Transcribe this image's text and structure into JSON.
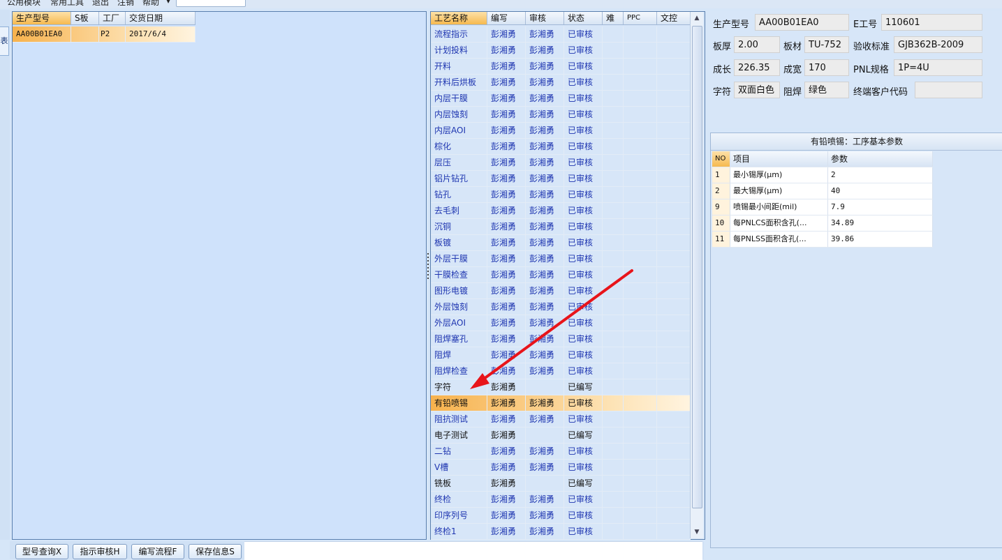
{
  "menu": {
    "items": [
      "公用模块",
      "常用工具",
      "退出",
      "注销",
      "帮助"
    ],
    "help_arrow": "▾"
  },
  "left_tab": {
    "label": "表"
  },
  "orders_grid": {
    "columns": [
      "生产型号",
      "S板",
      "工厂",
      "交货日期"
    ],
    "rows": [
      {
        "model": "AA00B01EA0",
        "s": "",
        "factory": "P2",
        "date": "2017/6/4"
      }
    ]
  },
  "process_grid": {
    "columns": [
      "工艺名称",
      "编写",
      "审核",
      "状态",
      "难",
      "PPC",
      "文控"
    ],
    "rows": [
      {
        "name": "流程指示",
        "writer": "彭湘勇",
        "reviewer": "彭湘勇",
        "status": "已审核"
      },
      {
        "name": "计划投料",
        "writer": "彭湘勇",
        "reviewer": "彭湘勇",
        "status": "已审核"
      },
      {
        "name": "开料",
        "writer": "彭湘勇",
        "reviewer": "彭湘勇",
        "status": "已审核"
      },
      {
        "name": "开料后烘板",
        "writer": "彭湘勇",
        "reviewer": "彭湘勇",
        "status": "已审核"
      },
      {
        "name": "内层干膜",
        "writer": "彭湘勇",
        "reviewer": "彭湘勇",
        "status": "已审核"
      },
      {
        "name": "内层蚀刻",
        "writer": "彭湘勇",
        "reviewer": "彭湘勇",
        "status": "已审核"
      },
      {
        "name": "内层AOI",
        "writer": "彭湘勇",
        "reviewer": "彭湘勇",
        "status": "已审核"
      },
      {
        "name": "棕化",
        "writer": "彭湘勇",
        "reviewer": "彭湘勇",
        "status": "已审核"
      },
      {
        "name": "层压",
        "writer": "彭湘勇",
        "reviewer": "彭湘勇",
        "status": "已审核"
      },
      {
        "name": "铝片钻孔",
        "writer": "彭湘勇",
        "reviewer": "彭湘勇",
        "status": "已审核"
      },
      {
        "name": "钻孔",
        "writer": "彭湘勇",
        "reviewer": "彭湘勇",
        "status": "已审核"
      },
      {
        "name": "去毛刺",
        "writer": "彭湘勇",
        "reviewer": "彭湘勇",
        "status": "已审核"
      },
      {
        "name": "沉铜",
        "writer": "彭湘勇",
        "reviewer": "彭湘勇",
        "status": "已审核"
      },
      {
        "name": "板镀",
        "writer": "彭湘勇",
        "reviewer": "彭湘勇",
        "status": "已审核"
      },
      {
        "name": "外层干膜",
        "writer": "彭湘勇",
        "reviewer": "彭湘勇",
        "status": "已审核"
      },
      {
        "name": "干膜检查",
        "writer": "彭湘勇",
        "reviewer": "彭湘勇",
        "status": "已审核"
      },
      {
        "name": "图形电镀",
        "writer": "彭湘勇",
        "reviewer": "彭湘勇",
        "status": "已审核"
      },
      {
        "name": "外层蚀刻",
        "writer": "彭湘勇",
        "reviewer": "彭湘勇",
        "status": "已审核"
      },
      {
        "name": "外层AOI",
        "writer": "彭湘勇",
        "reviewer": "彭湘勇",
        "status": "已审核"
      },
      {
        "name": "阻焊塞孔",
        "writer": "彭湘勇",
        "reviewer": "彭湘勇",
        "status": "已审核"
      },
      {
        "name": "阻焊",
        "writer": "彭湘勇",
        "reviewer": "彭湘勇",
        "status": "已审核"
      },
      {
        "name": "阻焊检查",
        "writer": "彭湘勇",
        "reviewer": "彭湘勇",
        "status": "已审核"
      },
      {
        "name": "字符",
        "writer": "彭湘勇",
        "reviewer": "",
        "status": "已编写"
      },
      {
        "name": "有铅喷锡",
        "writer": "彭湘勇",
        "reviewer": "彭湘勇",
        "status": "已审核"
      },
      {
        "name": "阻抗测试",
        "writer": "彭湘勇",
        "reviewer": "彭湘勇",
        "status": "已审核"
      },
      {
        "name": "电子测试",
        "writer": "彭湘勇",
        "reviewer": "",
        "status": "已编写"
      },
      {
        "name": "二钻",
        "writer": "彭湘勇",
        "reviewer": "彭湘勇",
        "status": "已审核"
      },
      {
        "name": "V槽",
        "writer": "彭湘勇",
        "reviewer": "彭湘勇",
        "status": "已审核"
      },
      {
        "name": "铣板",
        "writer": "彭湘勇",
        "reviewer": "",
        "status": "已编写"
      },
      {
        "name": "终检",
        "writer": "彭湘勇",
        "reviewer": "彭湘勇",
        "status": "已审核"
      },
      {
        "name": "印序列号",
        "writer": "彭湘勇",
        "reviewer": "彭湘勇",
        "status": "已审核"
      },
      {
        "name": "终检1",
        "writer": "彭湘勇",
        "reviewer": "彭湘勇",
        "status": "已审核"
      }
    ],
    "selected_row": "有铅喷锡"
  },
  "info": {
    "model_label": "生产型号",
    "model_value": "AA00B01EA0",
    "eno_label": "E工号",
    "eno_value": "110601",
    "thickness_label": "板厚",
    "thickness_value": "2.00",
    "material_label": "板材",
    "material_value": "TU-752",
    "standard_label": "验收标准",
    "standard_value": "GJB362B-2009",
    "length_label": "成长",
    "length_value": "226.35",
    "width_label": "成宽",
    "width_value": "170",
    "pnl_label": "PNL规格",
    "pnl_value": "1P=4U",
    "char_label": "字符",
    "char_value": "双面白色",
    "mask_label": "阻焊",
    "mask_value": "绿色",
    "customer_label": "终端客户代码",
    "customer_value": ""
  },
  "params": {
    "title": "有铅喷锡：工序基本参数",
    "columns": [
      "NO",
      "项目",
      "参数"
    ],
    "rows": [
      {
        "no": "1",
        "item": "最小锡厚(μm)",
        "value": "2"
      },
      {
        "no": "2",
        "item": "最大锡厚(μm)",
        "value": "40"
      },
      {
        "no": "9",
        "item": "喷锡最小间距(mil)",
        "value": "7.9"
      },
      {
        "no": "10",
        "item": "每PNLCS面积含孔(...",
        "value": "34.89"
      },
      {
        "no": "11",
        "item": "每PNLSS面积含孔(...",
        "value": "39.86"
      }
    ]
  },
  "buttons": {
    "query": "型号查询X",
    "review": "指示审核H",
    "write_flow": "编写流程F",
    "save_info": "保存信息S"
  },
  "colors": {
    "selected_row": "#f7b24d",
    "link_text": "#1e35b0",
    "arrow": "#e8141a"
  }
}
